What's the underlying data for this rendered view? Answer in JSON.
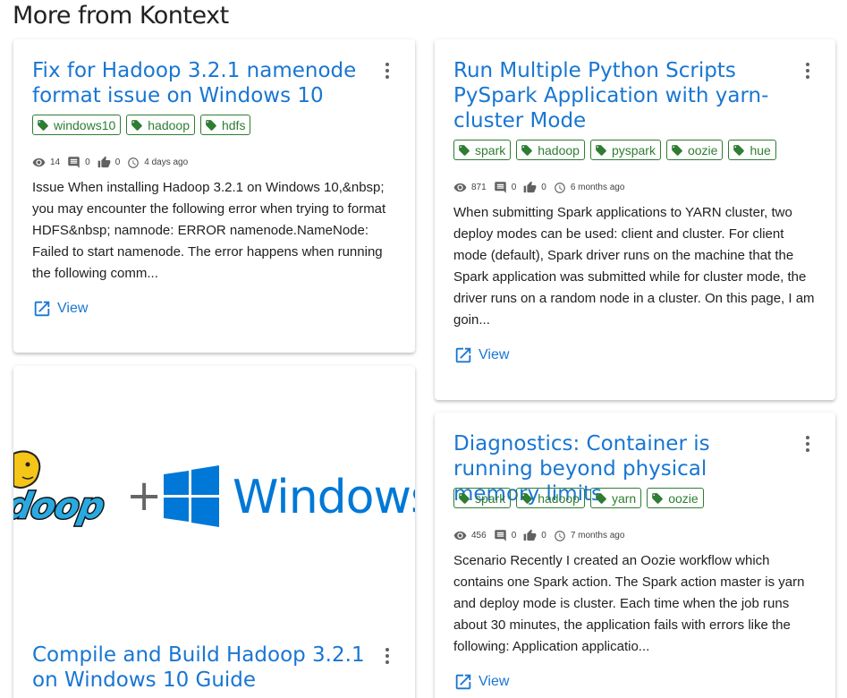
{
  "section": {
    "title": "More from Kontext"
  },
  "colors": {
    "link": "#1976d2",
    "tag": "#2e7d32"
  },
  "cards": [
    {
      "title": "Fix for Hadoop 3.2.1 namenode format issue on Windows 10",
      "tags": [
        "windows10",
        "hadoop",
        "hdfs"
      ],
      "views": "14",
      "comments": "0",
      "likes": "0",
      "time": "4 days ago",
      "excerpt": "Issue When installing Hadoop 3.2.1 on Windows 10,&nbsp; you may encounter the following error when trying to format HDFS&nbsp; namnode: ERROR namenode.NameNode: Failed to start namenode. The error happens when running the following comm...",
      "view_label": "View"
    },
    {
      "title": "Run Multiple Python Scripts PySpark Application with yarn-cluster Mode",
      "tags": [
        "spark",
        "hadoop",
        "pyspark",
        "oozie",
        "hue"
      ],
      "views": "871",
      "comments": "0",
      "likes": "0",
      "time": "6 months ago",
      "excerpt": "When submitting Spark applications to YARN cluster, two deploy modes can be used: client and cluster. For client mode (default), Spark driver runs on the machine that the Spark application was submitted while for cluster mode, the driver runs on a random node in a cluster. On this page, I am goin...",
      "view_label": "View"
    },
    {
      "title": "Compile and Build Hadoop 3.2.1 on Windows 10 Guide",
      "hero_plus": "+",
      "hero_windows": "Windows",
      "hero_hadoop": "doop"
    },
    {
      "title": "Diagnostics: Container is running beyond physical memory limits",
      "tags": [
        "spark",
        "hadoop",
        "yarn",
        "oozie"
      ],
      "views": "456",
      "comments": "0",
      "likes": "0",
      "time": "7 months ago",
      "excerpt": "Scenario Recently I created an Oozie workflow which contains one Spark action. The Spark action master is yarn and deploy mode is cluster. Each time when the job runs about 30 minutes, the application fails with errors like the following: Application applicatio...",
      "view_label": "View"
    }
  ]
}
